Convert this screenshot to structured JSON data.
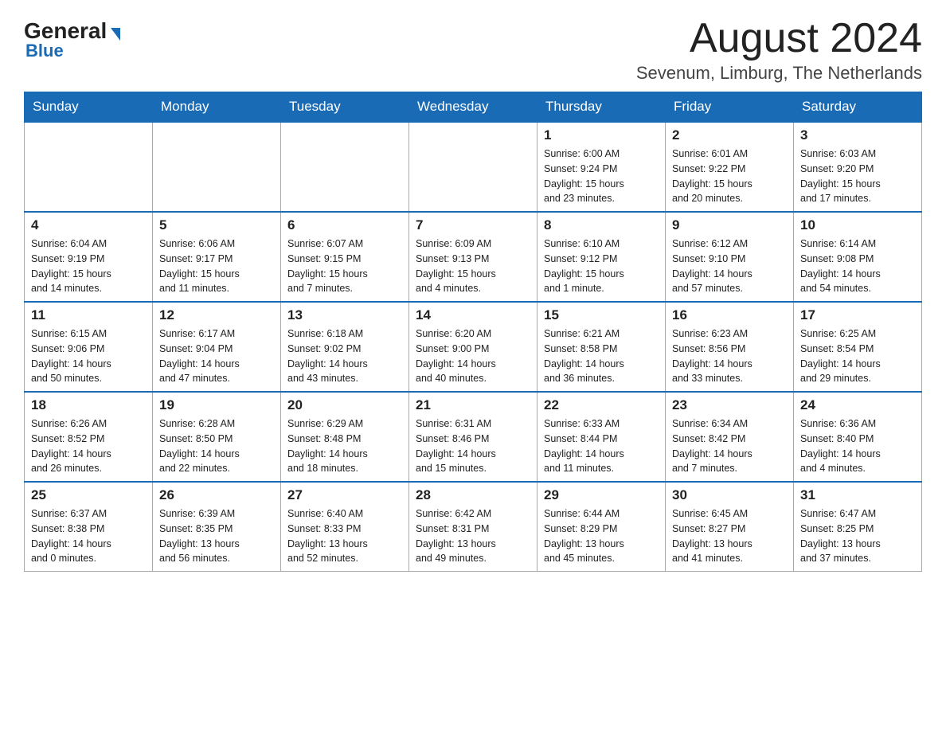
{
  "logo": {
    "general": "General",
    "blue": "Blue",
    "triangle": "▶"
  },
  "header": {
    "title": "August 2024",
    "subtitle": "Sevenum, Limburg, The Netherlands"
  },
  "weekdays": [
    "Sunday",
    "Monday",
    "Tuesday",
    "Wednesday",
    "Thursday",
    "Friday",
    "Saturday"
  ],
  "weeks": [
    [
      {
        "day": "",
        "info": ""
      },
      {
        "day": "",
        "info": ""
      },
      {
        "day": "",
        "info": ""
      },
      {
        "day": "",
        "info": ""
      },
      {
        "day": "1",
        "info": "Sunrise: 6:00 AM\nSunset: 9:24 PM\nDaylight: 15 hours\nand 23 minutes."
      },
      {
        "day": "2",
        "info": "Sunrise: 6:01 AM\nSunset: 9:22 PM\nDaylight: 15 hours\nand 20 minutes."
      },
      {
        "day": "3",
        "info": "Sunrise: 6:03 AM\nSunset: 9:20 PM\nDaylight: 15 hours\nand 17 minutes."
      }
    ],
    [
      {
        "day": "4",
        "info": "Sunrise: 6:04 AM\nSunset: 9:19 PM\nDaylight: 15 hours\nand 14 minutes."
      },
      {
        "day": "5",
        "info": "Sunrise: 6:06 AM\nSunset: 9:17 PM\nDaylight: 15 hours\nand 11 minutes."
      },
      {
        "day": "6",
        "info": "Sunrise: 6:07 AM\nSunset: 9:15 PM\nDaylight: 15 hours\nand 7 minutes."
      },
      {
        "day": "7",
        "info": "Sunrise: 6:09 AM\nSunset: 9:13 PM\nDaylight: 15 hours\nand 4 minutes."
      },
      {
        "day": "8",
        "info": "Sunrise: 6:10 AM\nSunset: 9:12 PM\nDaylight: 15 hours\nand 1 minute."
      },
      {
        "day": "9",
        "info": "Sunrise: 6:12 AM\nSunset: 9:10 PM\nDaylight: 14 hours\nand 57 minutes."
      },
      {
        "day": "10",
        "info": "Sunrise: 6:14 AM\nSunset: 9:08 PM\nDaylight: 14 hours\nand 54 minutes."
      }
    ],
    [
      {
        "day": "11",
        "info": "Sunrise: 6:15 AM\nSunset: 9:06 PM\nDaylight: 14 hours\nand 50 minutes."
      },
      {
        "day": "12",
        "info": "Sunrise: 6:17 AM\nSunset: 9:04 PM\nDaylight: 14 hours\nand 47 minutes."
      },
      {
        "day": "13",
        "info": "Sunrise: 6:18 AM\nSunset: 9:02 PM\nDaylight: 14 hours\nand 43 minutes."
      },
      {
        "day": "14",
        "info": "Sunrise: 6:20 AM\nSunset: 9:00 PM\nDaylight: 14 hours\nand 40 minutes."
      },
      {
        "day": "15",
        "info": "Sunrise: 6:21 AM\nSunset: 8:58 PM\nDaylight: 14 hours\nand 36 minutes."
      },
      {
        "day": "16",
        "info": "Sunrise: 6:23 AM\nSunset: 8:56 PM\nDaylight: 14 hours\nand 33 minutes."
      },
      {
        "day": "17",
        "info": "Sunrise: 6:25 AM\nSunset: 8:54 PM\nDaylight: 14 hours\nand 29 minutes."
      }
    ],
    [
      {
        "day": "18",
        "info": "Sunrise: 6:26 AM\nSunset: 8:52 PM\nDaylight: 14 hours\nand 26 minutes."
      },
      {
        "day": "19",
        "info": "Sunrise: 6:28 AM\nSunset: 8:50 PM\nDaylight: 14 hours\nand 22 minutes."
      },
      {
        "day": "20",
        "info": "Sunrise: 6:29 AM\nSunset: 8:48 PM\nDaylight: 14 hours\nand 18 minutes."
      },
      {
        "day": "21",
        "info": "Sunrise: 6:31 AM\nSunset: 8:46 PM\nDaylight: 14 hours\nand 15 minutes."
      },
      {
        "day": "22",
        "info": "Sunrise: 6:33 AM\nSunset: 8:44 PM\nDaylight: 14 hours\nand 11 minutes."
      },
      {
        "day": "23",
        "info": "Sunrise: 6:34 AM\nSunset: 8:42 PM\nDaylight: 14 hours\nand 7 minutes."
      },
      {
        "day": "24",
        "info": "Sunrise: 6:36 AM\nSunset: 8:40 PM\nDaylight: 14 hours\nand 4 minutes."
      }
    ],
    [
      {
        "day": "25",
        "info": "Sunrise: 6:37 AM\nSunset: 8:38 PM\nDaylight: 14 hours\nand 0 minutes."
      },
      {
        "day": "26",
        "info": "Sunrise: 6:39 AM\nSunset: 8:35 PM\nDaylight: 13 hours\nand 56 minutes."
      },
      {
        "day": "27",
        "info": "Sunrise: 6:40 AM\nSunset: 8:33 PM\nDaylight: 13 hours\nand 52 minutes."
      },
      {
        "day": "28",
        "info": "Sunrise: 6:42 AM\nSunset: 8:31 PM\nDaylight: 13 hours\nand 49 minutes."
      },
      {
        "day": "29",
        "info": "Sunrise: 6:44 AM\nSunset: 8:29 PM\nDaylight: 13 hours\nand 45 minutes."
      },
      {
        "day": "30",
        "info": "Sunrise: 6:45 AM\nSunset: 8:27 PM\nDaylight: 13 hours\nand 41 minutes."
      },
      {
        "day": "31",
        "info": "Sunrise: 6:47 AM\nSunset: 8:25 PM\nDaylight: 13 hours\nand 37 minutes."
      }
    ]
  ]
}
